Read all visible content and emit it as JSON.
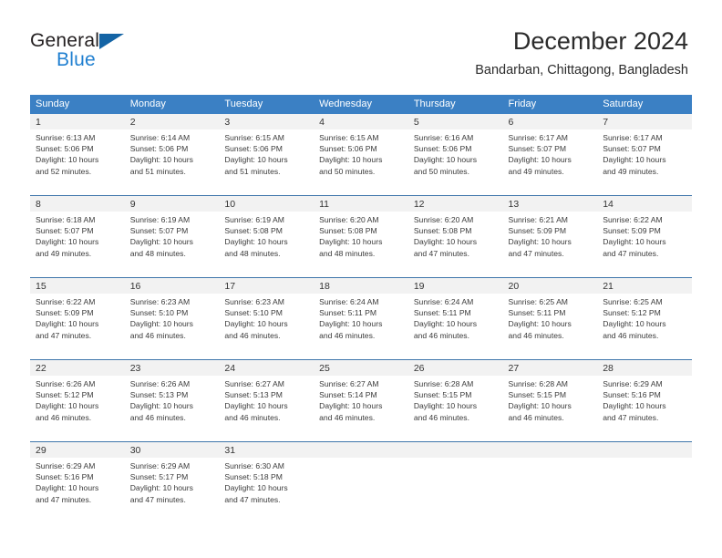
{
  "brand": {
    "name_top": "General",
    "name_bottom": "Blue",
    "triangle_color": "#1464a5",
    "blue_text_color": "#1f7fd0"
  },
  "header": {
    "title": "December 2024",
    "subtitle": "Bandarban, Chittagong, Bangladesh"
  },
  "theme": {
    "header_row_bg": "#3b80c4",
    "daynum_bg": "#f2f2f2",
    "week_divider": "#3f76ab"
  },
  "weekdays": [
    "Sunday",
    "Monday",
    "Tuesday",
    "Wednesday",
    "Thursday",
    "Friday",
    "Saturday"
  ],
  "weeks": [
    {
      "days": [
        {
          "num": "1",
          "sunrise": "Sunrise: 6:13 AM",
          "sunset": "Sunset: 5:06 PM",
          "daylight1": "Daylight: 10 hours",
          "daylight2": "and 52 minutes."
        },
        {
          "num": "2",
          "sunrise": "Sunrise: 6:14 AM",
          "sunset": "Sunset: 5:06 PM",
          "daylight1": "Daylight: 10 hours",
          "daylight2": "and 51 minutes."
        },
        {
          "num": "3",
          "sunrise": "Sunrise: 6:15 AM",
          "sunset": "Sunset: 5:06 PM",
          "daylight1": "Daylight: 10 hours",
          "daylight2": "and 51 minutes."
        },
        {
          "num": "4",
          "sunrise": "Sunrise: 6:15 AM",
          "sunset": "Sunset: 5:06 PM",
          "daylight1": "Daylight: 10 hours",
          "daylight2": "and 50 minutes."
        },
        {
          "num": "5",
          "sunrise": "Sunrise: 6:16 AM",
          "sunset": "Sunset: 5:06 PM",
          "daylight1": "Daylight: 10 hours",
          "daylight2": "and 50 minutes."
        },
        {
          "num": "6",
          "sunrise": "Sunrise: 6:17 AM",
          "sunset": "Sunset: 5:07 PM",
          "daylight1": "Daylight: 10 hours",
          "daylight2": "and 49 minutes."
        },
        {
          "num": "7",
          "sunrise": "Sunrise: 6:17 AM",
          "sunset": "Sunset: 5:07 PM",
          "daylight1": "Daylight: 10 hours",
          "daylight2": "and 49 minutes."
        }
      ]
    },
    {
      "days": [
        {
          "num": "8",
          "sunrise": "Sunrise: 6:18 AM",
          "sunset": "Sunset: 5:07 PM",
          "daylight1": "Daylight: 10 hours",
          "daylight2": "and 49 minutes."
        },
        {
          "num": "9",
          "sunrise": "Sunrise: 6:19 AM",
          "sunset": "Sunset: 5:07 PM",
          "daylight1": "Daylight: 10 hours",
          "daylight2": "and 48 minutes."
        },
        {
          "num": "10",
          "sunrise": "Sunrise: 6:19 AM",
          "sunset": "Sunset: 5:08 PM",
          "daylight1": "Daylight: 10 hours",
          "daylight2": "and 48 minutes."
        },
        {
          "num": "11",
          "sunrise": "Sunrise: 6:20 AM",
          "sunset": "Sunset: 5:08 PM",
          "daylight1": "Daylight: 10 hours",
          "daylight2": "and 48 minutes."
        },
        {
          "num": "12",
          "sunrise": "Sunrise: 6:20 AM",
          "sunset": "Sunset: 5:08 PM",
          "daylight1": "Daylight: 10 hours",
          "daylight2": "and 47 minutes."
        },
        {
          "num": "13",
          "sunrise": "Sunrise: 6:21 AM",
          "sunset": "Sunset: 5:09 PM",
          "daylight1": "Daylight: 10 hours",
          "daylight2": "and 47 minutes."
        },
        {
          "num": "14",
          "sunrise": "Sunrise: 6:22 AM",
          "sunset": "Sunset: 5:09 PM",
          "daylight1": "Daylight: 10 hours",
          "daylight2": "and 47 minutes."
        }
      ]
    },
    {
      "days": [
        {
          "num": "15",
          "sunrise": "Sunrise: 6:22 AM",
          "sunset": "Sunset: 5:09 PM",
          "daylight1": "Daylight: 10 hours",
          "daylight2": "and 47 minutes."
        },
        {
          "num": "16",
          "sunrise": "Sunrise: 6:23 AM",
          "sunset": "Sunset: 5:10 PM",
          "daylight1": "Daylight: 10 hours",
          "daylight2": "and 46 minutes."
        },
        {
          "num": "17",
          "sunrise": "Sunrise: 6:23 AM",
          "sunset": "Sunset: 5:10 PM",
          "daylight1": "Daylight: 10 hours",
          "daylight2": "and 46 minutes."
        },
        {
          "num": "18",
          "sunrise": "Sunrise: 6:24 AM",
          "sunset": "Sunset: 5:11 PM",
          "daylight1": "Daylight: 10 hours",
          "daylight2": "and 46 minutes."
        },
        {
          "num": "19",
          "sunrise": "Sunrise: 6:24 AM",
          "sunset": "Sunset: 5:11 PM",
          "daylight1": "Daylight: 10 hours",
          "daylight2": "and 46 minutes."
        },
        {
          "num": "20",
          "sunrise": "Sunrise: 6:25 AM",
          "sunset": "Sunset: 5:11 PM",
          "daylight1": "Daylight: 10 hours",
          "daylight2": "and 46 minutes."
        },
        {
          "num": "21",
          "sunrise": "Sunrise: 6:25 AM",
          "sunset": "Sunset: 5:12 PM",
          "daylight1": "Daylight: 10 hours",
          "daylight2": "and 46 minutes."
        }
      ]
    },
    {
      "days": [
        {
          "num": "22",
          "sunrise": "Sunrise: 6:26 AM",
          "sunset": "Sunset: 5:12 PM",
          "daylight1": "Daylight: 10 hours",
          "daylight2": "and 46 minutes."
        },
        {
          "num": "23",
          "sunrise": "Sunrise: 6:26 AM",
          "sunset": "Sunset: 5:13 PM",
          "daylight1": "Daylight: 10 hours",
          "daylight2": "and 46 minutes."
        },
        {
          "num": "24",
          "sunrise": "Sunrise: 6:27 AM",
          "sunset": "Sunset: 5:13 PM",
          "daylight1": "Daylight: 10 hours",
          "daylight2": "and 46 minutes."
        },
        {
          "num": "25",
          "sunrise": "Sunrise: 6:27 AM",
          "sunset": "Sunset: 5:14 PM",
          "daylight1": "Daylight: 10 hours",
          "daylight2": "and 46 minutes."
        },
        {
          "num": "26",
          "sunrise": "Sunrise: 6:28 AM",
          "sunset": "Sunset: 5:15 PM",
          "daylight1": "Daylight: 10 hours",
          "daylight2": "and 46 minutes."
        },
        {
          "num": "27",
          "sunrise": "Sunrise: 6:28 AM",
          "sunset": "Sunset: 5:15 PM",
          "daylight1": "Daylight: 10 hours",
          "daylight2": "and 46 minutes."
        },
        {
          "num": "28",
          "sunrise": "Sunrise: 6:29 AM",
          "sunset": "Sunset: 5:16 PM",
          "daylight1": "Daylight: 10 hours",
          "daylight2": "and 47 minutes."
        }
      ]
    },
    {
      "days": [
        {
          "num": "29",
          "sunrise": "Sunrise: 6:29 AM",
          "sunset": "Sunset: 5:16 PM",
          "daylight1": "Daylight: 10 hours",
          "daylight2": "and 47 minutes."
        },
        {
          "num": "30",
          "sunrise": "Sunrise: 6:29 AM",
          "sunset": "Sunset: 5:17 PM",
          "daylight1": "Daylight: 10 hours",
          "daylight2": "and 47 minutes."
        },
        {
          "num": "31",
          "sunrise": "Sunrise: 6:30 AM",
          "sunset": "Sunset: 5:18 PM",
          "daylight1": "Daylight: 10 hours",
          "daylight2": "and 47 minutes."
        },
        {
          "num": "",
          "sunrise": "",
          "sunset": "",
          "daylight1": "",
          "daylight2": ""
        },
        {
          "num": "",
          "sunrise": "",
          "sunset": "",
          "daylight1": "",
          "daylight2": ""
        },
        {
          "num": "",
          "sunrise": "",
          "sunset": "",
          "daylight1": "",
          "daylight2": ""
        },
        {
          "num": "",
          "sunrise": "",
          "sunset": "",
          "daylight1": "",
          "daylight2": ""
        }
      ]
    }
  ]
}
